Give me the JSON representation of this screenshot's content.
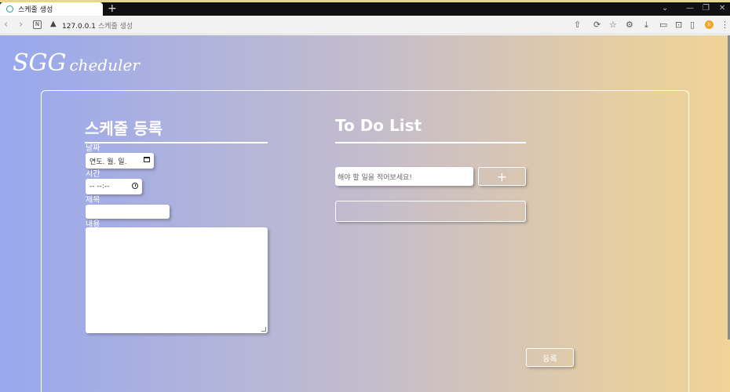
{
  "browser": {
    "tab_title": "스케줄 생성",
    "new_tab_symbol": "+",
    "url_host": "127.0.0.1",
    "url_path": "스케줄 생성",
    "profile_initial": "k"
  },
  "page": {
    "logo_big": "SGG",
    "logo_small": "cheduler",
    "schedule": {
      "title": "스케줄 등록",
      "date_label": "날짜",
      "date_placeholder": "연도. 월. 일.",
      "time_label": "시간",
      "time_placeholder": "-- --:--",
      "subject_label": "제목",
      "subject_value": "",
      "content_label": "내용",
      "content_value": ""
    },
    "todo": {
      "title": "To Do List",
      "input_placeholder": "해야 할 일을 적어보세요!",
      "add_label": "+"
    },
    "submit_label": "등록"
  },
  "colors": {
    "gradient_left": "#98a8ee",
    "gradient_right": "#f0d397",
    "accent_tab_line": "#e6d78a"
  }
}
